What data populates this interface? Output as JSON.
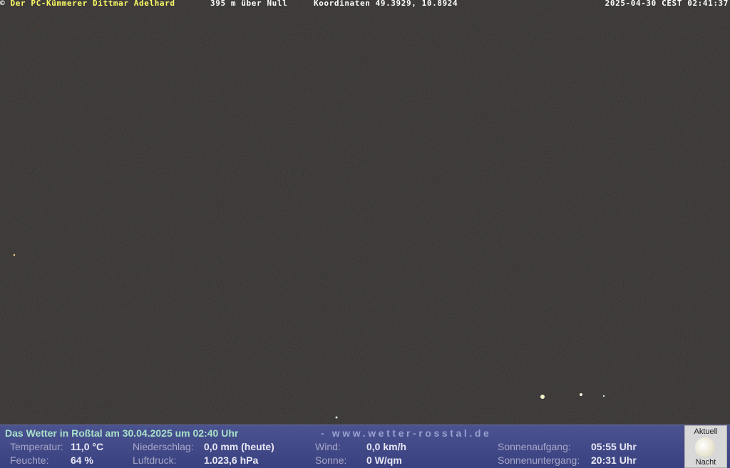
{
  "overlay": {
    "copyright_symbol": "©",
    "owner": "Der PC-Kümmerer Dittmar Adelhard",
    "altitude": "395 m über Null",
    "coordinates": "Koordinaten 49.3929, 10.8924",
    "timestamp": "2025-04-30 CEST 02:41:37"
  },
  "weather": {
    "headline": "Das Wetter in Roßtal am 30.04.2025 um 02:40 Uhr",
    "website": "- www.wetter-rosstal.de",
    "temperature_label": "Temperatur:",
    "temperature_value": "11,0 °C",
    "humidity_label": "Feuchte:",
    "humidity_value": "64 %",
    "precip_label": "Niederschlag:",
    "precip_value": "0,0 mm (heute)",
    "pressure_label": "Luftdruck:",
    "pressure_value": "1.023,6 hPa",
    "wind_label": "Wind:",
    "wind_value": "0,0 km/h",
    "sun_label": "Sonne:",
    "sun_value": "0 W/qm",
    "sunrise_label": "Sonnenaufgang:",
    "sunrise_value": "05:55 Uhr",
    "sunset_label": "Sonnenuntergang:",
    "sunset_value": "20:31 Uhr"
  },
  "moon": {
    "top_label": "Aktuell",
    "bottom_label": "Nacht",
    "icon": "full-moon-icon"
  },
  "colors": {
    "overlay_owner": "#ffff66",
    "overlay_text": "#ffffff",
    "panel_bg": "#424a88",
    "headline": "#a8e0c8"
  }
}
